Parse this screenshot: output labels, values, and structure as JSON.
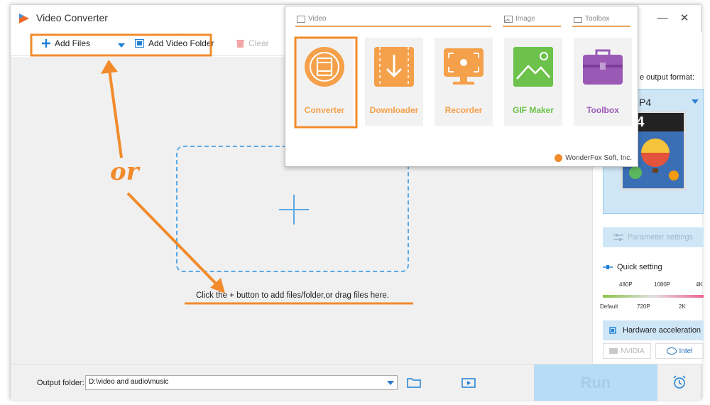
{
  "window": {
    "title": "Video Converter",
    "minimize": "—",
    "close": "✕"
  },
  "toolbar": {
    "add_files": "Add Files",
    "add_folder": "Add Video Folder",
    "clear": "Clear"
  },
  "main": {
    "hint": "Click the + button to add files/folder,or drag files here."
  },
  "right_panel": {
    "format_label": "e output format:",
    "format_name": "P4",
    "format_thumb_text": "P4",
    "parameter_settings": "Parameter settings",
    "quick_setting": "Quick setting",
    "scale_top": [
      "480P",
      "1080P",
      "4K"
    ],
    "scale_bottom": [
      "Default",
      "720P",
      "2K"
    ],
    "hardware_acceleration": "Hardware acceleration",
    "nvidia": "NVIDIA",
    "intel": "Intel"
  },
  "bottom": {
    "output_folder_label": "Output folder:",
    "output_folder_value": "D:\\video and audio\\music",
    "run": "Run"
  },
  "popup": {
    "section_video": "Video",
    "section_image": "Image",
    "section_toolbox": "Toolbox",
    "tiles": [
      "Converter",
      "Downloader",
      "Recorder",
      "GIF Maker",
      "Toolbox"
    ],
    "company": "WonderFox Soft, Inc."
  },
  "annotation": {
    "or": "or"
  },
  "colors": {
    "accent_orange": "#f18b2c",
    "tile_orange": "#f5a04a",
    "gif_green": "#6cc24a",
    "toolbox_purple": "#9b59b6",
    "selection_blue": "#cfe6f7",
    "dashed_blue": "#5aa9e6"
  }
}
